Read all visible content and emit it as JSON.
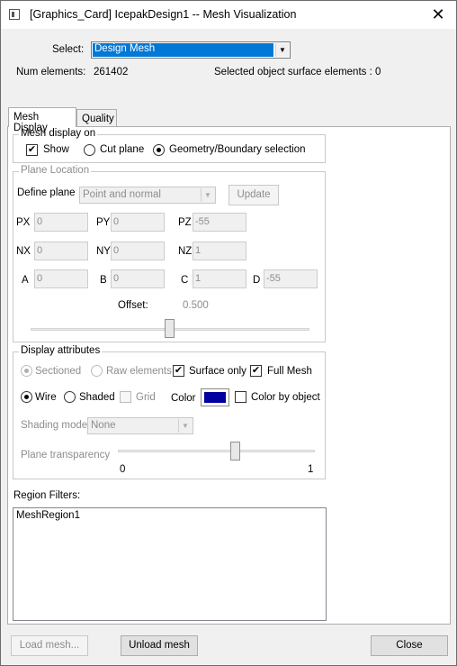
{
  "window": {
    "title": "[Graphics_Card] IcepakDesign1 -- Mesh Visualization",
    "close_glyph": "✕"
  },
  "select": {
    "label": "Select:",
    "value": "Design Mesh"
  },
  "info": {
    "num_elements_label": "Num elements:",
    "num_elements_value": "261402",
    "selected_surface_label": "Selected object surface elements : 0"
  },
  "tabs": [
    {
      "label": "Mesh Display"
    },
    {
      "label": "Quality"
    }
  ],
  "mesh_display_on": {
    "legend": "Mesh display on",
    "show": {
      "label": "Show",
      "checked": true
    },
    "cut_plane": {
      "label": "Cut plane",
      "selected": false
    },
    "geometry": {
      "label": "Geometry/Boundary selection",
      "selected": true
    }
  },
  "plane_location": {
    "legend": "Plane Location",
    "define_plane_label": "Define plane",
    "define_plane_value": "Point and normal",
    "update_label": "Update",
    "px": {
      "label": "PX",
      "value": "0"
    },
    "py": {
      "label": "PY",
      "value": "0"
    },
    "pz": {
      "label": "PZ",
      "value": "-55"
    },
    "nx": {
      "label": "NX",
      "value": "0"
    },
    "ny": {
      "label": "NY",
      "value": "0"
    },
    "nz": {
      "label": "NZ",
      "value": "1"
    },
    "a": {
      "label": "A",
      "value": "0"
    },
    "b": {
      "label": "B",
      "value": "0"
    },
    "c": {
      "label": "C",
      "value": "1"
    },
    "d": {
      "label": "D",
      "value": "-55"
    },
    "offset_label": "Offset:",
    "offset_value": "0.500"
  },
  "display_attributes": {
    "legend": "Display attributes",
    "sectioned": {
      "label": "Sectioned",
      "selected": true
    },
    "raw_elements": {
      "label": "Raw elements",
      "selected": false
    },
    "surface_only": {
      "label": "Surface only",
      "checked": true
    },
    "full_mesh": {
      "label": "Full Mesh",
      "checked": true
    },
    "wire": {
      "label": "Wire",
      "selected": true
    },
    "shaded": {
      "label": "Shaded",
      "selected": false
    },
    "grid": {
      "label": "Grid",
      "checked": false
    },
    "color_label": "Color",
    "color_value": "#0000a0",
    "color_by_object": {
      "label": "Color by object",
      "checked": false
    },
    "shading_mode_label": "Shading mode",
    "shading_mode_value": "None",
    "plane_transparency_label": "Plane transparency",
    "slider_min": "0",
    "slider_max": "1"
  },
  "region_filters": {
    "label": "Region Filters:",
    "items": [
      "MeshRegion1"
    ]
  },
  "footer": {
    "load_mesh_label": "Load mesh...",
    "unload_mesh_label": "Unload mesh",
    "close_label": "Close"
  },
  "icons": {
    "dropdown": "▼",
    "check": "✔"
  }
}
